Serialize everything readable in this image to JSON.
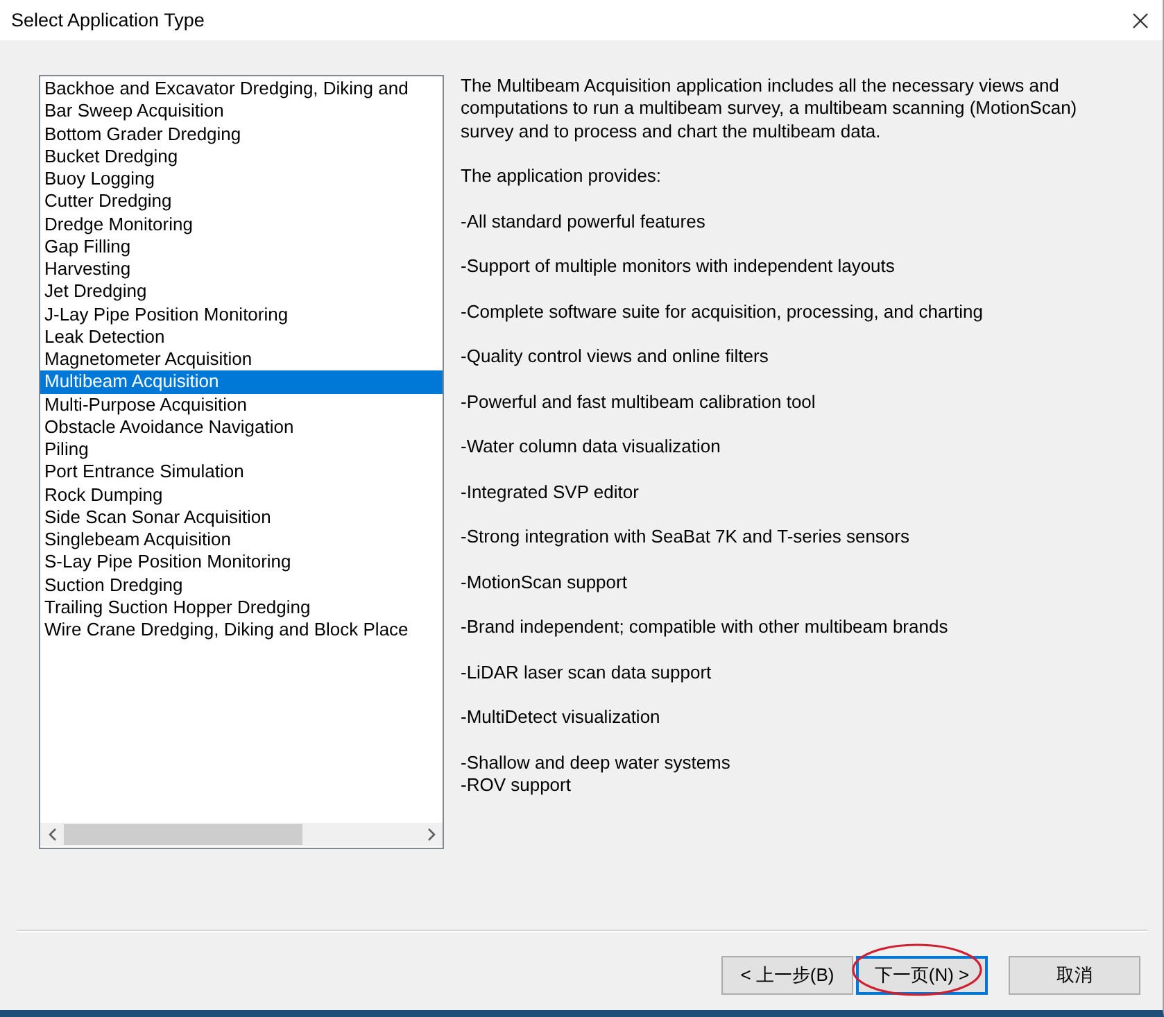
{
  "window": {
    "title": "Select Application Type"
  },
  "applications": [
    {
      "label": "Backhoe and Excavator Dredging, Diking and",
      "selected": false
    },
    {
      "label": "Bar Sweep Acquisition",
      "selected": false
    },
    {
      "label": "Bottom Grader Dredging",
      "selected": false
    },
    {
      "label": "Bucket Dredging",
      "selected": false
    },
    {
      "label": "Buoy Logging",
      "selected": false
    },
    {
      "label": "Cutter Dredging",
      "selected": false
    },
    {
      "label": "Dredge Monitoring",
      "selected": false
    },
    {
      "label": "Gap Filling",
      "selected": false
    },
    {
      "label": "Harvesting",
      "selected": false
    },
    {
      "label": "Jet Dredging",
      "selected": false
    },
    {
      "label": "J-Lay Pipe Position Monitoring",
      "selected": false
    },
    {
      "label": "Leak Detection",
      "selected": false
    },
    {
      "label": "Magnetometer Acquisition",
      "selected": false
    },
    {
      "label": "Multibeam Acquisition",
      "selected": true
    },
    {
      "label": "Multi-Purpose Acquisition",
      "selected": false
    },
    {
      "label": "Obstacle Avoidance Navigation",
      "selected": false
    },
    {
      "label": "Piling",
      "selected": false
    },
    {
      "label": "Port Entrance Simulation",
      "selected": false
    },
    {
      "label": "Rock Dumping",
      "selected": false
    },
    {
      "label": "Side Scan Sonar Acquisition",
      "selected": false
    },
    {
      "label": "Singlebeam Acquisition",
      "selected": false
    },
    {
      "label": "S-Lay Pipe Position Monitoring",
      "selected": false
    },
    {
      "label": "Suction Dredging",
      "selected": false
    },
    {
      "label": "Trailing Suction Hopper Dredging",
      "selected": false
    },
    {
      "label": "Wire Crane Dredging, Diking and Block Place",
      "selected": false
    }
  ],
  "description": {
    "intro": "The Multibeam Acquisition application includes all the necessary views and computations to run a multibeam survey, a multibeam scanning (MotionScan) survey and to process and chart the multibeam data.",
    "provides": "The application provides:",
    "paragraphs": [
      [
        "-All standard powerful features"
      ],
      [
        "-Support of multiple monitors with independent layouts"
      ],
      [
        "-Complete software suite for acquisition, processing, and charting"
      ],
      [
        "-Quality control views and online filters"
      ],
      [
        "-Powerful and fast multibeam calibration tool"
      ],
      [
        "-Water column data visualization"
      ],
      [
        "-Integrated SVP editor"
      ],
      [
        "-Strong integration with SeaBat 7K and T-series sensors"
      ],
      [
        "-MotionScan support"
      ],
      [
        "-Brand independent; compatible with other multibeam brands"
      ],
      [
        "-LiDAR laser scan data support"
      ],
      [
        "-MultiDetect visualization"
      ],
      [
        "-Shallow and deep water systems",
        "-ROV support"
      ]
    ]
  },
  "buttons": [
    {
      "label": "< 上一步(B)",
      "focused": false,
      "circled": false
    },
    {
      "label": "下一页(N) >",
      "focused": true,
      "circled": true
    },
    {
      "label": "取消",
      "focused": false,
      "circled": false
    }
  ]
}
